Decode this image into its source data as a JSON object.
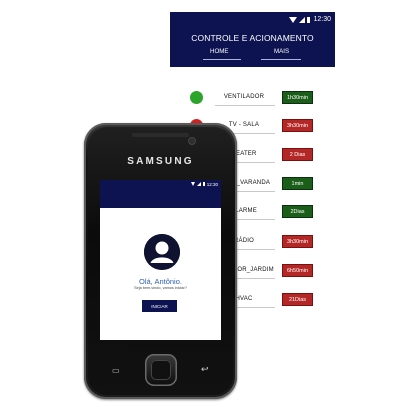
{
  "app": {
    "status_time": "12:30",
    "title": "CONTROLE E ACIONAMENTO",
    "tabs": [
      "HOME",
      "MAIS"
    ],
    "devices": [
      {
        "name": "VENTILADOR",
        "badge": "1h30min",
        "badge_color": "green",
        "indicator": "green"
      },
      {
        "name": "TV - SALA",
        "badge": "3h30min",
        "badge_color": "red",
        "indicator": "red"
      },
      {
        "name": "HEATER",
        "badge": "2 Dias",
        "badge_color": "red"
      },
      {
        "name": "LIGHT_VARANDA",
        "badge": "1min",
        "badge_color": "green"
      },
      {
        "name": "ALARME",
        "badge": "2Dias",
        "badge_color": "green"
      },
      {
        "name": "RÁDIO",
        "badge": "3h30min",
        "badge_color": "red"
      },
      {
        "name": "REGADOR_JARDIM",
        "badge": "6h50min",
        "badge_color": "red"
      },
      {
        "name": "HVAC",
        "badge": "21Dias",
        "badge_color": "red"
      }
    ]
  },
  "phone": {
    "brand": "SAMSUNG",
    "status_time": "12:30",
    "greeting": "Olá, Antônio.",
    "subtext": "Seja bem-vindo, vamos iniciar?",
    "start_button": "INICIAR"
  },
  "colors": {
    "header_navy": "#0c1350",
    "green_badge": "#1a5e1a",
    "red_badge": "#b42727",
    "greeting_blue": "#2f5fb3"
  },
  "icons": [
    "wifi-icon",
    "signal-icon",
    "battery-icon",
    "user-avatar-icon",
    "menu-icon",
    "back-icon",
    "home-button"
  ]
}
